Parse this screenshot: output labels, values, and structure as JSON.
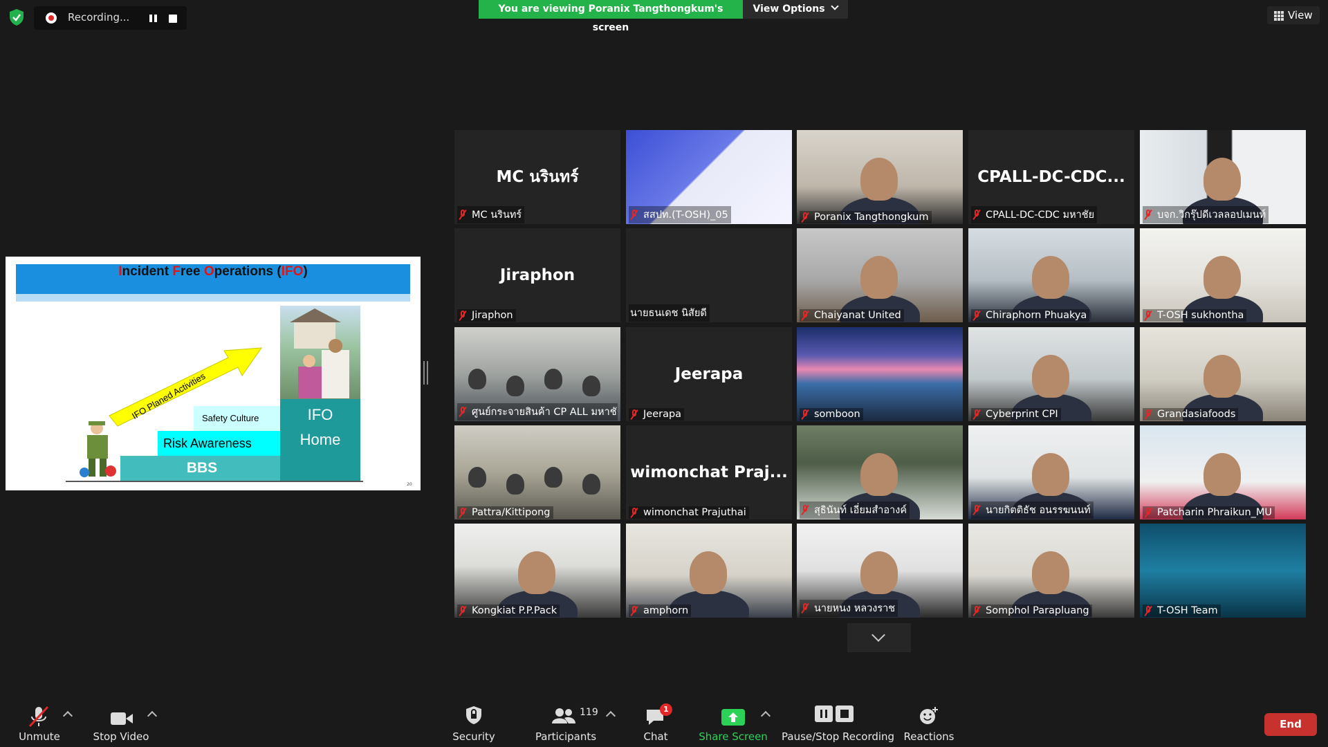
{
  "top_bar": {
    "recording_label": "Recording...",
    "viewing_banner": "You are viewing Poranix Tangthongkum's screen",
    "view_options_label": "View Options",
    "view_label": "View"
  },
  "slide": {
    "title_parts": [
      "I",
      "ncident ",
      "F",
      "ree ",
      "O",
      "perations (",
      "IFO",
      ")"
    ],
    "arrow_label": "IFO Planed  Activities",
    "steps": {
      "bbs": "BBS",
      "risk": "Risk Awareness",
      "safety": "Safety Culture",
      "ifo": "IFO",
      "home": "Home"
    },
    "page_number": "20"
  },
  "participants": [
    {
      "name": "MC นรินทร์",
      "big": "MC นรินทร์"
    },
    {
      "name": "สสปท.(T-OSH)_05",
      "big": ""
    },
    {
      "name": "Poranix Tangthongkum",
      "big": ""
    },
    {
      "name": "CPALL-DC-CDC มหาชัย",
      "big": "CPALL-DC-CDC..."
    },
    {
      "name": "บจก.วิกรุ๊ปดีเวลลอปเมนท์",
      "big": ""
    },
    {
      "name": "Jiraphon",
      "big": "Jiraphon"
    },
    {
      "name": "นายธนเดช นิสัยดี",
      "big": ""
    },
    {
      "name": "Chaiyanat United",
      "big": ""
    },
    {
      "name": "Chiraphorn Phuakya",
      "big": ""
    },
    {
      "name": "T-OSH sukhontha",
      "big": ""
    },
    {
      "name": "ศูนย์กระจายสินค้า CP ALL มหาชัย",
      "big": ""
    },
    {
      "name": "Jeerapa",
      "big": "Jeerapa"
    },
    {
      "name": "somboon",
      "big": ""
    },
    {
      "name": "Cyberprint CPI",
      "big": ""
    },
    {
      "name": "Grandasiafoods",
      "big": ""
    },
    {
      "name": "Pattra/Kittipong",
      "big": ""
    },
    {
      "name": "wimonchat Prajuthai",
      "big": "wimonchat  Praj..."
    },
    {
      "name": "สุธินันท์ เอี่ยมสำอางค์",
      "big": ""
    },
    {
      "name": "นายกิตติธัช อนรรฆนนท์",
      "big": ""
    },
    {
      "name": "Patcharin Phraikun_MU",
      "big": ""
    },
    {
      "name": "Kongkiat P.P.Pack",
      "big": ""
    },
    {
      "name": "amphorn",
      "big": ""
    },
    {
      "name": "นายหนง หลวงราช",
      "big": ""
    },
    {
      "name": "Somphol Parapluang",
      "big": ""
    },
    {
      "name": "T-OSH Team",
      "big": ""
    }
  ],
  "toolbar": {
    "unmute": "Unmute",
    "stop_video": "Stop Video",
    "security": "Security",
    "participants": "Participants",
    "participant_count": "119",
    "chat": "Chat",
    "chat_badge": "1",
    "share_screen": "Share Screen",
    "pause_recording": "Pause/Stop Recording",
    "reactions": "Reactions",
    "end": "End"
  },
  "colors": {
    "banner_green": "#24b34a",
    "share_green": "#2cd158",
    "end_red": "#c8322e",
    "active_speaker": "#e7e77a"
  }
}
